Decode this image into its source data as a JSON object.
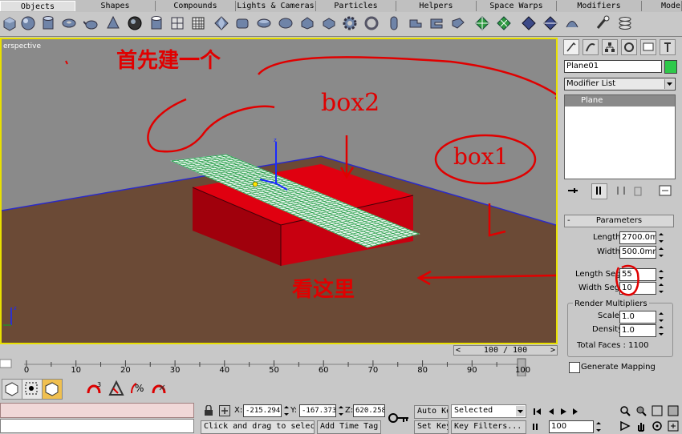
{
  "tabs": {
    "items": [
      {
        "label": "Objects",
        "active": true
      },
      {
        "label": "Shapes"
      },
      {
        "label": "Compounds"
      },
      {
        "label": "Lights & Cameras"
      },
      {
        "label": "Particles"
      },
      {
        "label": "Helpers"
      },
      {
        "label": "Space Warps"
      },
      {
        "label": "Modifiers"
      },
      {
        "label": "Mode"
      }
    ]
  },
  "viewport": {
    "label": "erspective"
  },
  "annotations": {
    "top": "首先建一个",
    "box2": "box2",
    "box1": "box1",
    "bottom": "看这里"
  },
  "panel": {
    "object_name": "Plane01",
    "object_color": "#2ec94a",
    "modifier_list": "Modifier List",
    "stack_item": "Plane",
    "params_title": "Parameters",
    "length_label": "Length:",
    "length_value": "2700.0m",
    "width_label": "Width:",
    "width_value": "500.0mm",
    "length_segs_label": "Length Segs:",
    "length_segs_value": "55",
    "width_segs_label": "Width Segs:",
    "width_segs_value": "10",
    "render_mult_title": "Render Multipliers",
    "scale_label": "Scale:",
    "scale_value": "1.0",
    "density_label": "Density:",
    "density_value": "1.0",
    "total_faces": "Total Faces : 1100",
    "gen_mapping": "Generate Mapping"
  },
  "timeline": {
    "slider": "100 / 100",
    "ticks": [
      "0",
      "10",
      "20",
      "30",
      "40",
      "50",
      "60",
      "70",
      "80",
      "90",
      "100"
    ]
  },
  "status": {
    "x_label": "X:",
    "x_value": "-215.294",
    "y_label": "Y:",
    "y_value": "-167.373",
    "z_label": "Z:",
    "z_value": "620.258",
    "prompt": "Click and drag to select",
    "add_time_tag": "Add Time Tag",
    "auto_key": "Auto Key",
    "set_key": "Set Key",
    "selected": "Selected",
    "key_filters": "Key Filters...",
    "frame": "100"
  },
  "colors": {
    "red_box": "#e00010",
    "ground": "#6b4a36",
    "plane_grid": "#1e9a40",
    "annotation": "#e00000"
  }
}
